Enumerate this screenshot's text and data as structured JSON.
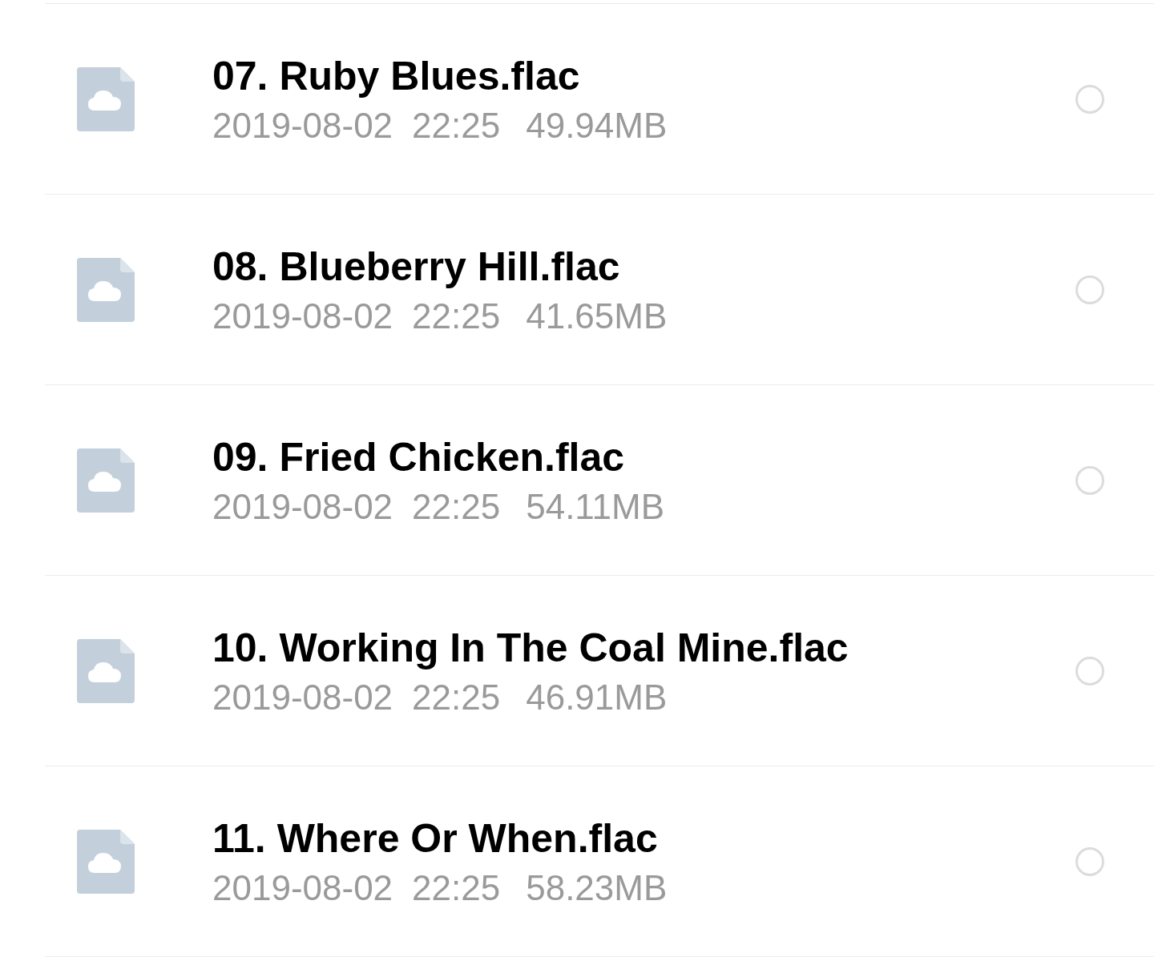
{
  "files": [
    {
      "name": "07. Ruby Blues.flac",
      "date": "2019-08-02",
      "time": "22:25",
      "size": "49.94MB",
      "selected": false
    },
    {
      "name": "08. Blueberry Hill.flac",
      "date": "2019-08-02",
      "time": "22:25",
      "size": "41.65MB",
      "selected": false
    },
    {
      "name": "09. Fried Chicken.flac",
      "date": "2019-08-02",
      "time": "22:25",
      "size": "54.11MB",
      "selected": false
    },
    {
      "name": "10. Working In The Coal Mine.flac",
      "date": "2019-08-02",
      "time": "22:25",
      "size": "46.91MB",
      "selected": false
    },
    {
      "name": "11. Where Or When.flac",
      "date": "2019-08-02",
      "time": "22:25",
      "size": "58.23MB",
      "selected": false
    }
  ]
}
